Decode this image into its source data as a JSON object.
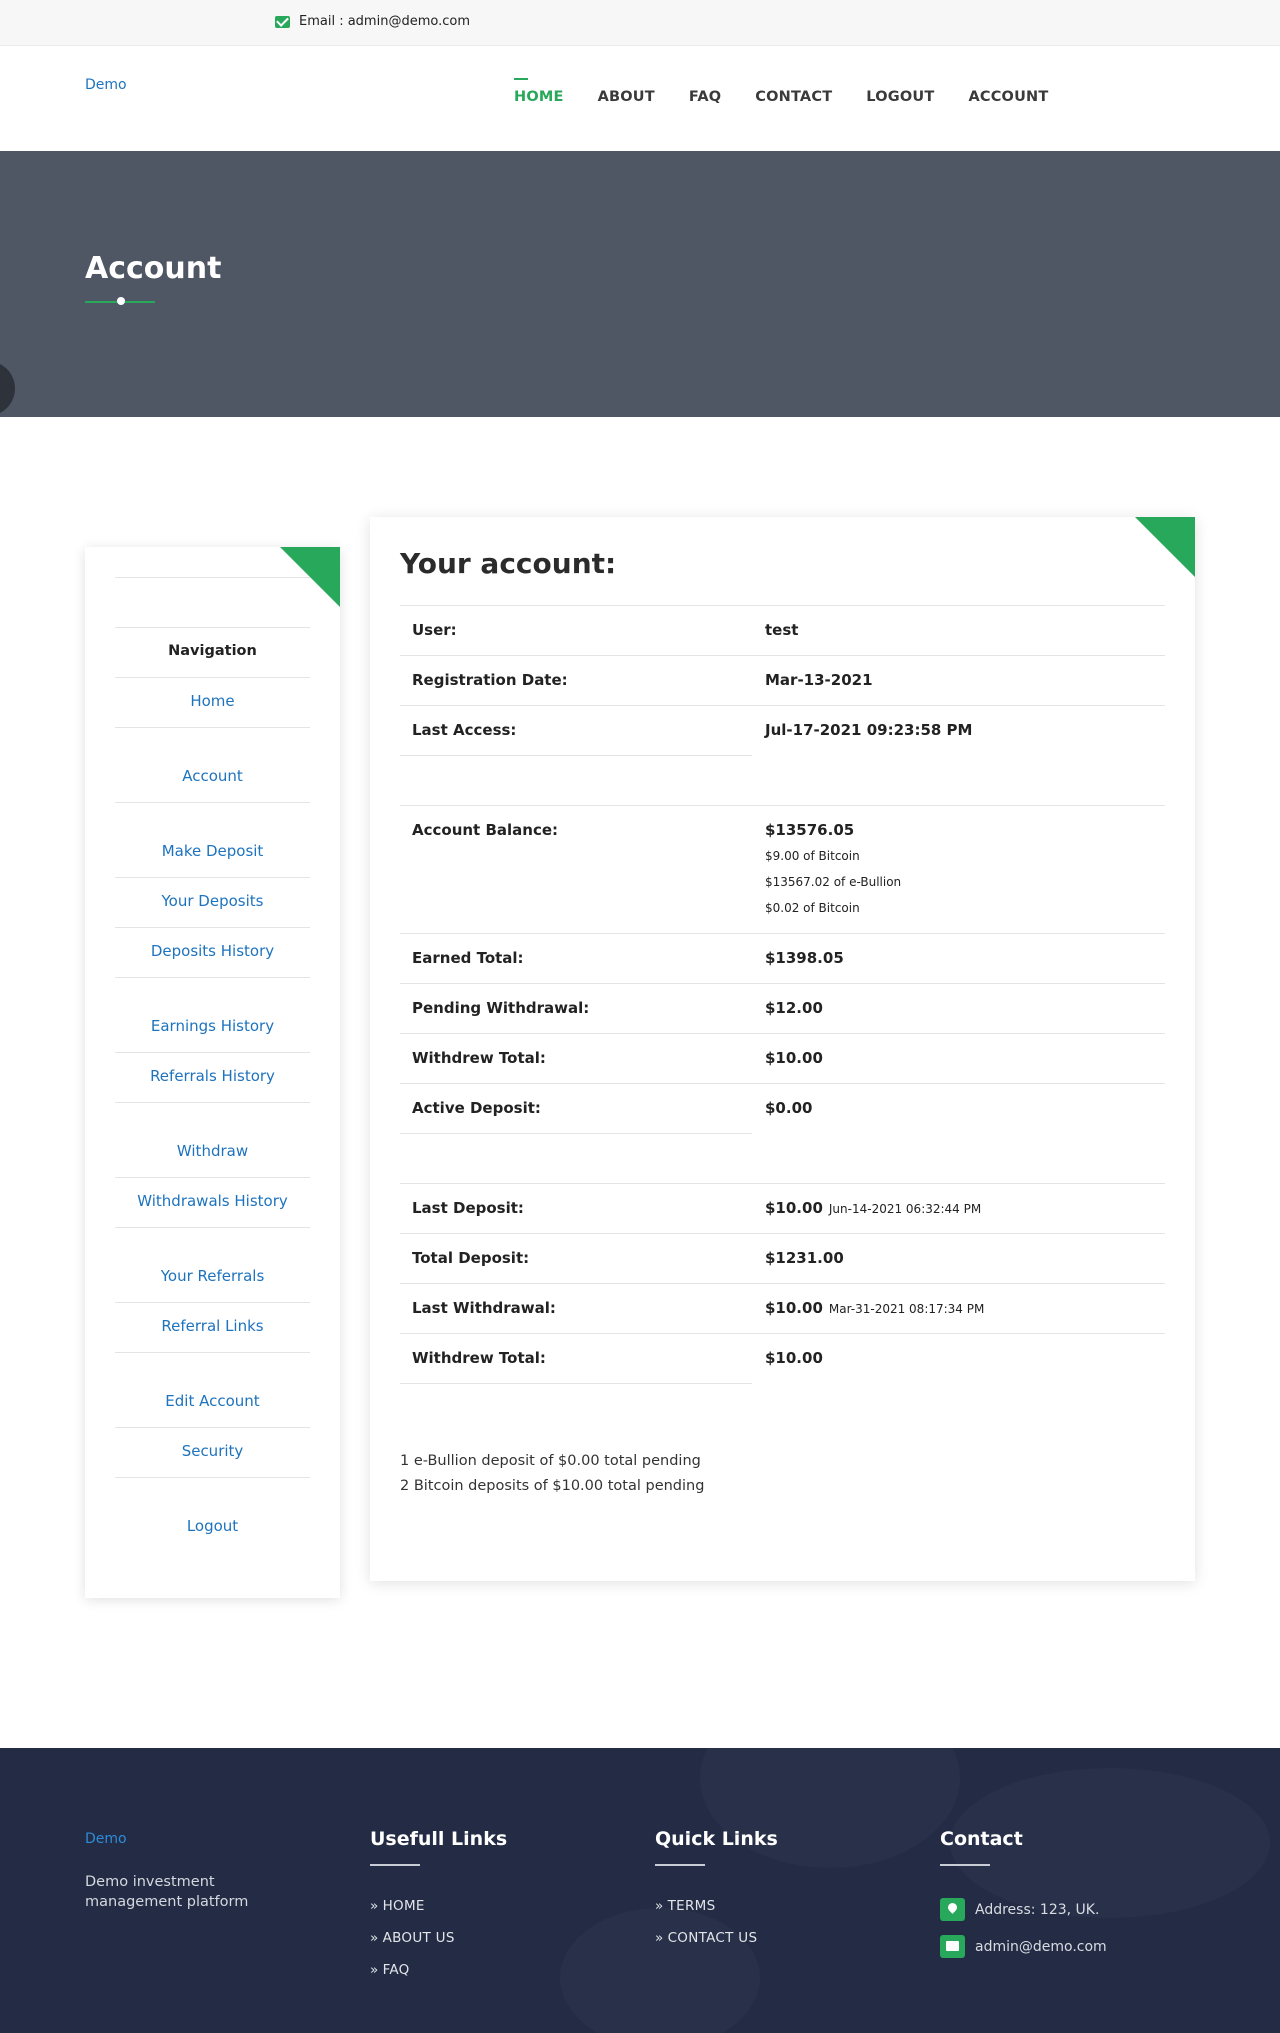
{
  "topbar": {
    "email": "Email : admin@demo.com"
  },
  "header": {
    "logo": "Demo",
    "nav": [
      "HOME",
      "ABOUT",
      "FAQ",
      "CONTACT",
      "LOGOUT",
      "ACCOUNT"
    ]
  },
  "hero": {
    "title": "Account"
  },
  "sidebar": {
    "title": "Navigation",
    "items": [
      "Home",
      "Account",
      "Make Deposit",
      "Your Deposits",
      "Deposits History",
      "Earnings History",
      "Referrals History",
      "Withdraw",
      "Withdrawals History",
      "Your Referrals",
      "Referral Links",
      "Edit Account",
      "Security",
      "Logout"
    ]
  },
  "account": {
    "heading": "Your account:",
    "user_label": "User:",
    "user_value": "test",
    "regdate_label": "Registration Date:",
    "regdate_value": "Mar-13-2021",
    "lastaccess_label": "Last Access:",
    "lastaccess_value": "Jul-17-2021 09:23:58 PM",
    "balance_label": "Account Balance:",
    "balance_value": "$13576.05",
    "balance_breakdown": [
      "$9.00 of Bitcoin",
      "$13567.02 of e-Bullion",
      "$0.02 of Bitcoin"
    ],
    "earned_label": "Earned Total:",
    "earned_value": "$1398.05",
    "pending_label": "Pending Withdrawal:",
    "pending_value": "$12.00",
    "withdrew_label": "Withdrew Total:",
    "withdrew_value": "$10.00",
    "active_label": "Active Deposit:",
    "active_value": "$0.00",
    "lastdep_label": "Last Deposit:",
    "lastdep_value": "$10.00",
    "lastdep_date": "Jun-14-2021 06:32:44 PM",
    "totaldep_label": "Total Deposit:",
    "totaldep_value": "$1231.00",
    "lastwd_label": "Last Withdrawal:",
    "lastwd_value": "$10.00",
    "lastwd_date": "Mar-31-2021 08:17:34 PM",
    "withdrew2_label": "Withdrew Total:",
    "withdrew2_value": "$10.00",
    "notes": [
      "1 e-Bullion deposit of $0.00 total pending",
      "2 Bitcoin deposits of $10.00 total pending"
    ]
  },
  "footer": {
    "logo": "Demo",
    "description": "Demo investment management platform",
    "useful_title": "Usefull Links",
    "useful_links": [
      "HOME",
      "ABOUT US",
      "FAQ"
    ],
    "quick_title": "Quick Links",
    "quick_links": [
      "TERMS",
      "CONTACT US"
    ],
    "contact_title": "Contact",
    "address": "Address: 123, UK.",
    "email": "admin@demo.com"
  },
  "colors": {
    "accent": "#28a85a",
    "link": "#1e73be",
    "hero_bg": "#4f5664",
    "footer_bg": "#232c44"
  }
}
